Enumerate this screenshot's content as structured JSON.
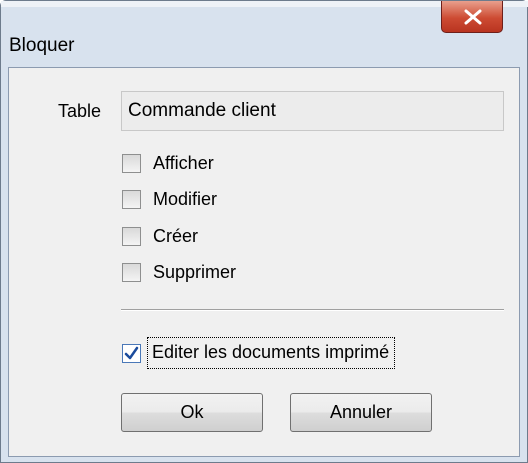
{
  "window": {
    "title": "Bloquer"
  },
  "title_bar": {
    "close_icon": "close-x-icon"
  },
  "table": {
    "label": "Table",
    "value": "Commande client"
  },
  "permissions": [
    {
      "label": "Afficher",
      "checked": false
    },
    {
      "label": "Modifier",
      "checked": false
    },
    {
      "label": "Créer",
      "checked": false
    },
    {
      "label": "Supprimer",
      "checked": false
    }
  ],
  "print_option": {
    "label": "Editer les documents imprimé",
    "checked": true
  },
  "buttons": {
    "ok": "Ok",
    "cancel": "Annuler"
  },
  "colors": {
    "close_button": "#c7412a",
    "check_mark": "#1b4b9c"
  }
}
